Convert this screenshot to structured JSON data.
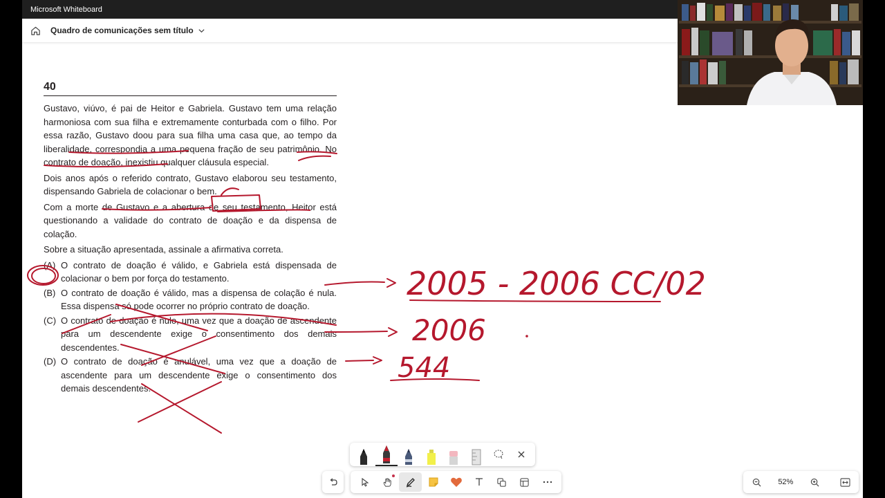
{
  "window": {
    "title": "Microsoft Whiteboard"
  },
  "header": {
    "board_title": "Quadro de comunicações sem título"
  },
  "question": {
    "number": "40",
    "paragraphs": [
      "Gustavo, viúvo, é pai de Heitor e Gabriela. Gustavo tem uma relação harmoniosa com sua filha e extremamente conturbada com o filho. Por essa razão, Gustavo doou para sua filha uma casa que, ao tempo da liberalidade, correspondia a uma pequena fração de seu patrimônio. No contrato de doação, inexistiu qualquer cláusula especial.",
      "Dois anos após o referido contrato, Gustavo elaborou seu testamento, dispensando Gabriela de colacionar o bem.",
      "Com a morte de Gustavo e a abertura de seu testamento, Heitor está questionando a validade do contrato de doação e da dispensa de colação.",
      "Sobre a situação apresentada, assinale a afirmativa correta."
    ],
    "options": [
      {
        "letter": "(A)",
        "text": "O contrato de doação é válido, e Gabriela está dispensada de colacionar o bem por força do testamento."
      },
      {
        "letter": "(B)",
        "text": "O contrato de doação é válido, mas a dispensa de colação é nula. Essa dispensa só pode ocorrer no próprio contrato de doação."
      },
      {
        "letter": "(C)",
        "text": "O contrato de doação é nulo, uma vez que a doação de ascendente para um descendente exige o consentimento dos demais descendentes."
      },
      {
        "letter": "(D)",
        "text": "O contrato de doação é anulável, uma vez que a doação de ascendente para um descendente exige o consentimento dos demais descendentes."
      }
    ]
  },
  "handwriting": {
    "note_1": "2005 - 2006 CC/02",
    "note_2": "2006",
    "note_3": "544"
  },
  "ink_color": "#b5182d",
  "pen_tray": {
    "pens": [
      {
        "name": "black-pen",
        "color": "#1b1b1b"
      },
      {
        "name": "red-pen",
        "color": "#c4202f"
      },
      {
        "name": "blue-gray-pen",
        "color": "#3a4a6b"
      },
      {
        "name": "yellow-highlighter",
        "color": "#f2f04a"
      },
      {
        "name": "eraser",
        "color": "#f0a8b0"
      },
      {
        "name": "ruler",
        "color": "#bdbdbd"
      }
    ]
  },
  "zoom": {
    "level": "52%"
  }
}
